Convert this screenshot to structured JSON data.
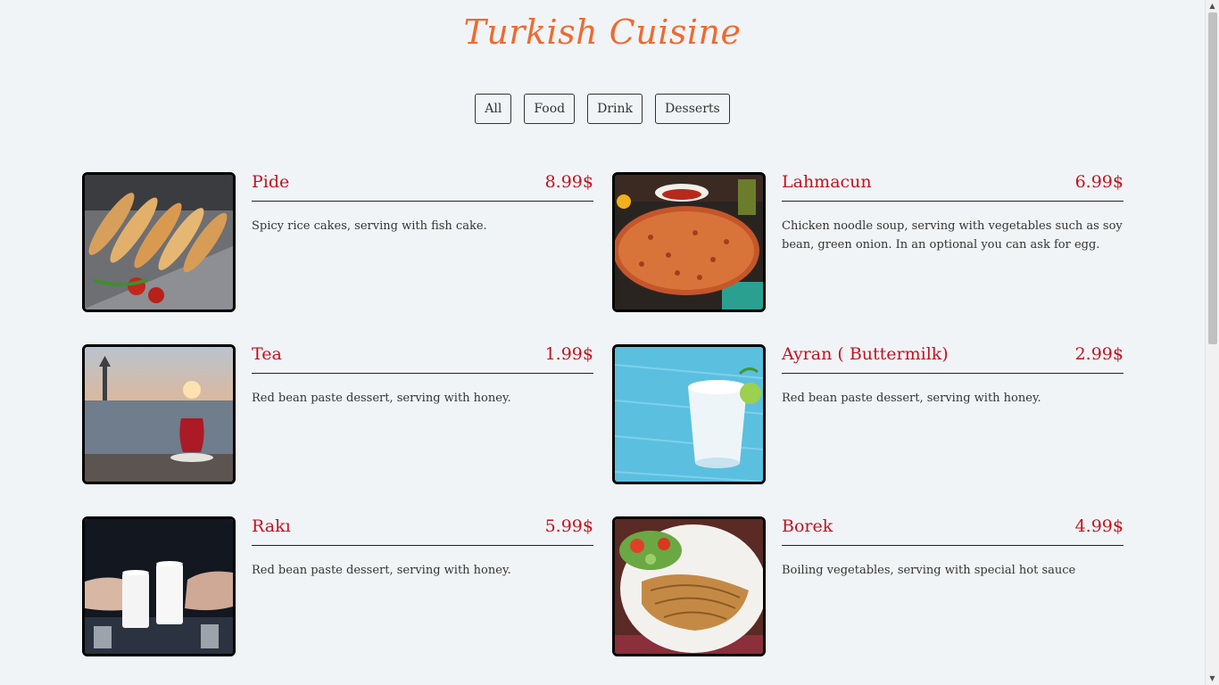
{
  "title": "Turkish Cuisine",
  "filters": [
    "All",
    "Food",
    "Drink",
    "Desserts"
  ],
  "items": [
    {
      "name": "Pide",
      "price": "8.99$",
      "desc": "Spicy rice cakes, serving with fish cake."
    },
    {
      "name": "Lahmacun",
      "price": "6.99$",
      "desc": "Chicken noodle soup, serving with vegetables such as soy bean, green onion. In an optional you can ask for egg."
    },
    {
      "name": "Tea",
      "price": "1.99$",
      "desc": "Red bean paste dessert, serving with honey."
    },
    {
      "name": "Ayran ( Buttermilk)",
      "price": "2.99$",
      "desc": "Red bean paste dessert, serving with honey."
    },
    {
      "name": "Rakı",
      "price": "5.99$",
      "desc": "Red bean paste dessert, serving with honey."
    },
    {
      "name": "Borek",
      "price": "4.99$",
      "desc": "Boiling vegetables, serving with special hot sauce"
    }
  ],
  "icons": {
    "scroll_up": "scroll-up-arrow-icon",
    "scroll_down": "scroll-down-arrow-icon"
  }
}
